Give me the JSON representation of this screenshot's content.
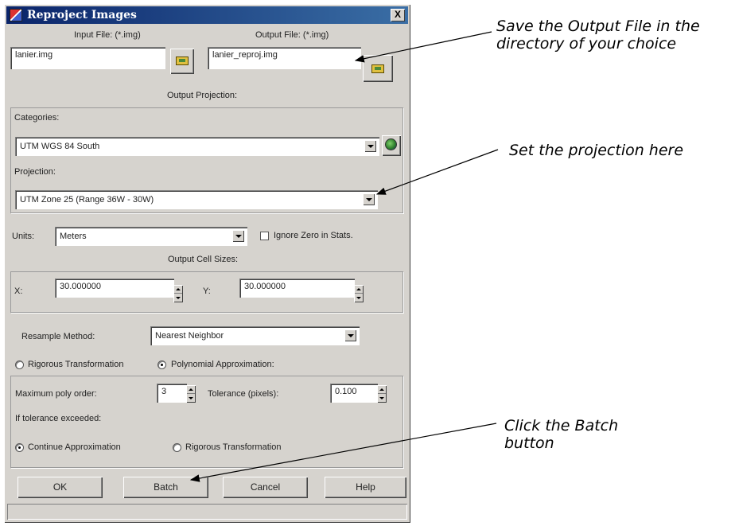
{
  "window": {
    "title": "Reproject Images",
    "close_symbol": "X"
  },
  "input": {
    "label": "Input File: (*.img)",
    "value": "lanier.img"
  },
  "output": {
    "label": "Output File: (*.img)",
    "value": "lanier_reproj.img"
  },
  "projection_section": {
    "header": "Output Projection:",
    "categories_label": "Categories:",
    "categories_value": "UTM WGS 84 South",
    "projection_label": "Projection:",
    "projection_value": "UTM Zone 25  (Range 36W - 30W)"
  },
  "units": {
    "label": "Units:",
    "value": "Meters",
    "ignore_zero_label": "Ignore Zero in Stats."
  },
  "cell_sizes": {
    "header": "Output Cell Sizes:",
    "x_label": "X:",
    "x_value": "30.000000",
    "y_label": "Y:",
    "y_value": "30.000000"
  },
  "resample": {
    "label": "Resample Method:",
    "value": "Nearest Neighbor"
  },
  "transform": {
    "rigorous_label": "Rigorous Transformation",
    "polynomial_label": "Polynomial Approximation:",
    "selected": "polynomial"
  },
  "poly": {
    "max_order_label": "Maximum poly order:",
    "max_order_value": "3",
    "tolerance_label": "Tolerance (pixels):",
    "tolerance_value": "0.100",
    "exceeded_label": "If tolerance exceeded:",
    "continue_label": "Continue Approximation",
    "rigorous_label": "Rigorous Transformation",
    "exceeded_selected": "continue"
  },
  "buttons": {
    "ok": "OK",
    "batch": "Batch",
    "cancel": "Cancel",
    "help": "Help"
  },
  "callouts": {
    "save_output": "Save the Output File in the directory of your choice",
    "set_projection": "Set the projection here",
    "click_batch": "Click the Batch button"
  },
  "icons": {
    "folder": "folder-open-icon",
    "globe": "globe-icon"
  }
}
